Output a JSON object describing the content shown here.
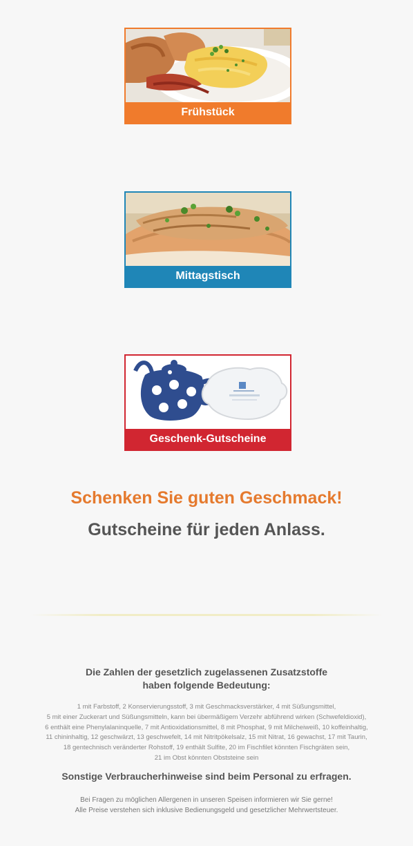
{
  "tiles": [
    {
      "label": "Frühstück",
      "color": "#f07b2c"
    },
    {
      "label": "Mittagstisch",
      "color": "#1f86b7"
    },
    {
      "label": "Geschenk-Gutscheine",
      "color": "#d12631"
    }
  ],
  "promo": {
    "headline": "Schenken Sie guten Geschmack!",
    "subline": "Gutscheine für jeden Anlass."
  },
  "additives": {
    "title_line1": "Die Zahlen der gesetzlich zugelassenen Zusatzstoffe",
    "title_line2": "haben folgende Bedeutung:",
    "lines": [
      "1 mit Farbstoff, 2 Konservierungsstoff, 3 mit Geschmacksverstärker, 4 mit Süßungsmittel,",
      "5 mit einer Zuckerart und Süßungsmitteln, kann bei übermäßigem Verzehr abführend wirken (Schwefeldioxid),",
      "6 enthält eine Phenylalaninquelle, 7 mit Antioxidationsmittel, 8 mit Phosphat, 9 mit Milcheiweiß, 10 koffeinhaltig,",
      "11 chininhaltig, 12 geschwärzt, 13 geschwefelt, 14 mit Nitritpökelsalz, 15 mit Nitrat, 16 gewachst, 17 mit Taurin,",
      "18 gentechnisch veränderter Rohstoff, 19 enthält Sulfite, 20 im Fischfilet könnten Fischgräten sein,",
      "21 im Obst könnten Obststeine sein"
    ]
  },
  "consumer_note": "Sonstige Verbraucherhinweise sind beim Personal zu erfragen.",
  "footer": {
    "line1": "Bei Fragen zu möglichen Allergenen in unseren Speisen informieren wir Sie gerne!",
    "line2": "Alle Preise verstehen sich inklusive Bedienungsgeld und gesetzlicher Mehrwertsteuer."
  }
}
